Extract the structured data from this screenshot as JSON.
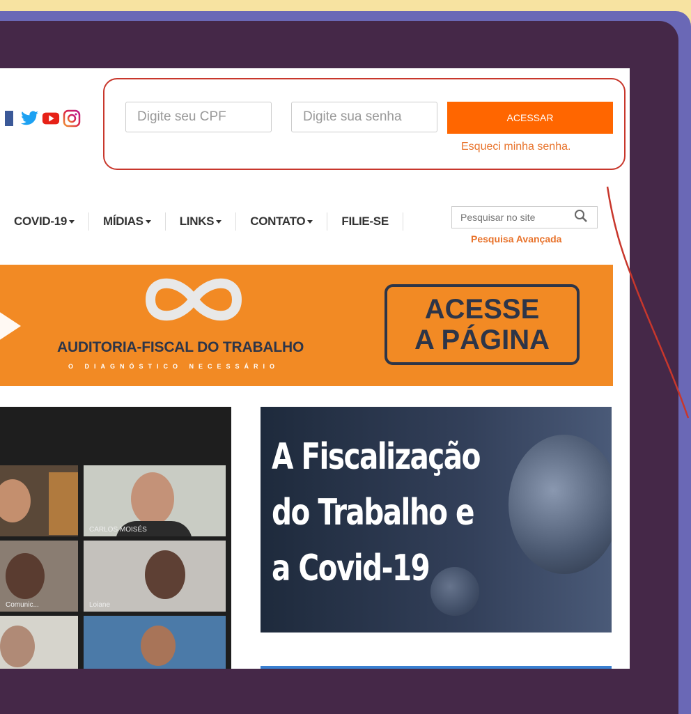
{
  "header": {
    "social": [
      "facebook-icon",
      "twitter-icon",
      "youtube-icon",
      "instagram-icon"
    ],
    "cpf_placeholder": "Digite seu CPF",
    "password_placeholder": "Digite sua senha",
    "login_button": "ACESSAR",
    "forgot_link": "Esqueci minha senha."
  },
  "nav": {
    "items": [
      "COVID-19",
      "MÍDIAS",
      "LINKS",
      "CONTATO",
      "FILIE-SE"
    ],
    "search_placeholder": "Pesquisar no site",
    "advanced_search": "Pesquisa Avançada"
  },
  "banner": {
    "title": "AUDITORIA-FISCAL DO TRABALHO",
    "subtitle": "O DIAGNÓSTICO NECESSÁRIO",
    "cta_line1": "ACESSE",
    "cta_line2": "A PÁGINA"
  },
  "video": {
    "participants": [
      "CARLOS MOISÉS",
      "Loiane",
      "Comunic..."
    ]
  },
  "covid_card": {
    "line1": "A Fiscalização",
    "line2": "do Trabalho e",
    "line3": "a Covid-19"
  },
  "colors": {
    "accent_orange": "#ff6600",
    "annotation_red": "#c8372c",
    "frame_purple": "#452848",
    "frame_lavender": "#6a68b6"
  }
}
